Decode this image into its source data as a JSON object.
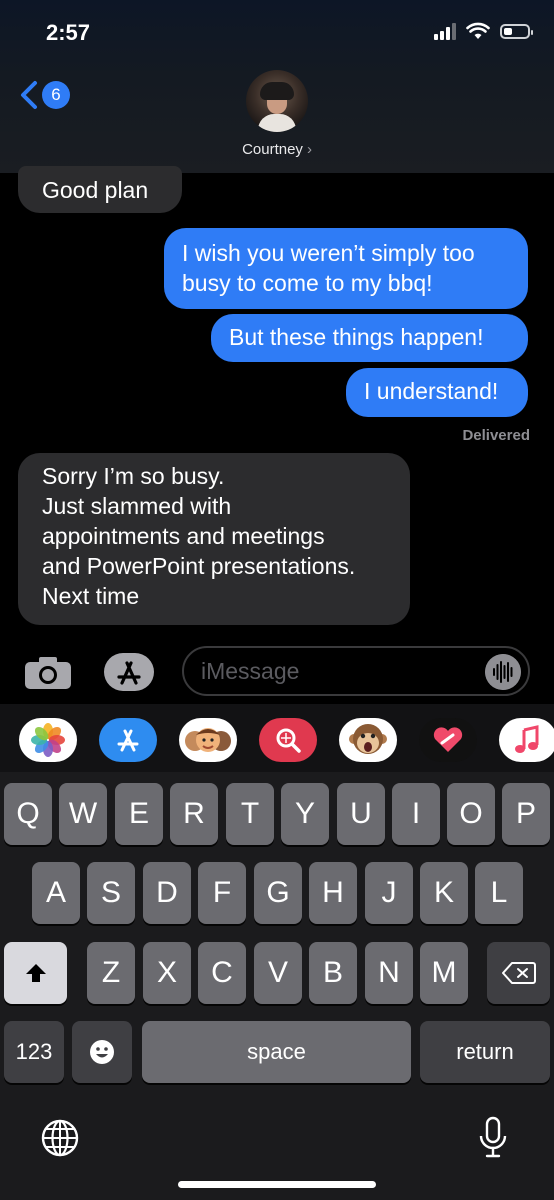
{
  "status": {
    "time": "2:57"
  },
  "nav": {
    "back_count": "6"
  },
  "contact": {
    "name": "Courtney",
    "chevron": "›"
  },
  "messages": [
    {
      "side": "received",
      "text": "Good plan"
    },
    {
      "side": "sent",
      "text": "I wish you weren’t simply too\nbusy to come to my bbq!"
    },
    {
      "side": "sent",
      "text": "But these things happen!"
    },
    {
      "side": "sent",
      "text": "I understand!"
    },
    {
      "side": "received",
      "text": "Sorry I’m so busy.\nJust slammed with\nappointments and meetings\nand PowerPoint presentations.\nNext time"
    }
  ],
  "delivered_label": "Delivered",
  "composer": {
    "placeholder": "iMessage"
  },
  "apps": [
    "photos-icon",
    "app-store-icon",
    "memoji-icon",
    "images-search-icon",
    "animoji-icon",
    "digital-touch-icon",
    "music-icon"
  ],
  "keyboard": {
    "row1": [
      "Q",
      "W",
      "E",
      "R",
      "T",
      "Y",
      "U",
      "I",
      "O",
      "P"
    ],
    "row2": [
      "A",
      "S",
      "D",
      "F",
      "G",
      "H",
      "J",
      "K",
      "L"
    ],
    "row3": [
      "Z",
      "X",
      "C",
      "V",
      "B",
      "N",
      "M"
    ],
    "numbers_label": "123",
    "space_label": "space",
    "return_label": "return"
  },
  "colors": {
    "sent_bubble": "#2f7cf6",
    "received_bubble": "#2c2c2e",
    "badge": "#2f7cf6"
  }
}
